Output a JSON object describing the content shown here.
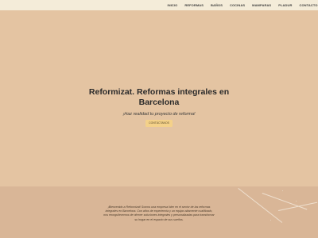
{
  "nav": {
    "items": [
      "INICIO",
      "REFORMAS",
      "BAÑOS",
      "COCINAS",
      "MAMPARAS",
      "PLADUR",
      "CONTACTO"
    ]
  },
  "hero": {
    "title": "Reformizat. Reformas integrales en Barcelona",
    "subtitle": "¡Haz realidad tu proyecto de reforma!",
    "cta_label": "CONTÁCTANOS"
  },
  "intro": {
    "text": "¡Bienvenido a Reformizat! Somos una empresa líder en el sector de las reformas integrales en Barcelona. Con años de experiencia y un equipo altamente cualificado, nos enorgullecemos de ofrecer soluciones integrales y personalizadas para transformar su hogar en el espacio de sus sueños."
  },
  "colors": {
    "topbar": "#f4ecd9",
    "hero_bg": "#e4c4a2",
    "cta_bg": "#f4d189",
    "section_bg": "#d9b697"
  }
}
